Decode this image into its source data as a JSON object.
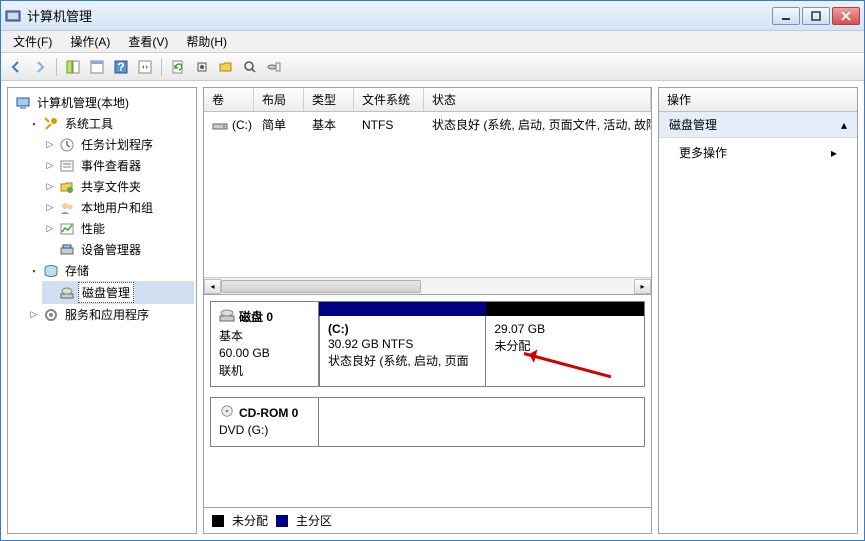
{
  "titlebar": {
    "title": "计算机管理"
  },
  "menu": {
    "file": "文件(F)",
    "action": "操作(A)",
    "view": "查看(V)",
    "help": "帮助(H)"
  },
  "tree": {
    "root": "计算机管理(本地)",
    "systools": "系统工具",
    "scheduler": "任务计划程序",
    "eventviewer": "事件查看器",
    "sharedfolders": "共享文件夹",
    "localusers": "本地用户和组",
    "performance": "性能",
    "devmgr": "设备管理器",
    "storage": "存储",
    "diskmgmt": "磁盘管理",
    "services": "服务和应用程序"
  },
  "volheaders": {
    "vol": "卷",
    "layout": "布局",
    "type": "类型",
    "fs": "文件系统",
    "status": "状态"
  },
  "volrow": {
    "name": "(C:)",
    "layout": "简单",
    "type": "基本",
    "fs": "NTFS",
    "status": "状态良好 (系统, 启动, 页面文件, 活动, 故障转储, 主分区)"
  },
  "disk0": {
    "title": "磁盘 0",
    "kind": "基本",
    "size": "60.00 GB",
    "state": "联机",
    "partC": {
      "name": "(C:)",
      "size_fs": "30.92 GB NTFS",
      "status": "状态良好 (系统, 启动, 页面"
    },
    "unalloc": {
      "size": "29.07 GB",
      "label": "未分配"
    }
  },
  "cdrom": {
    "title": "CD-ROM 0",
    "line2": "DVD (G:)"
  },
  "legend": {
    "unalloc": "未分配",
    "primary": "主分区"
  },
  "actions": {
    "header": "操作",
    "group": "磁盘管理",
    "more": "更多操作"
  }
}
